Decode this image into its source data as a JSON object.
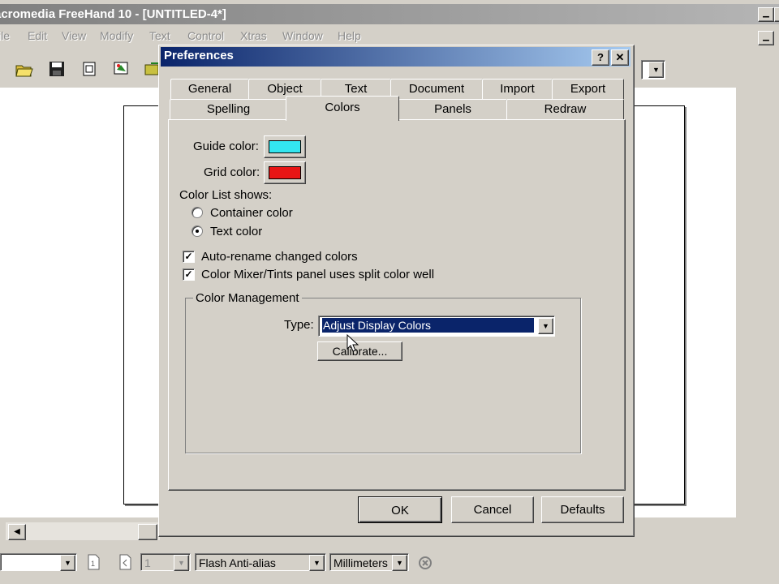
{
  "app": {
    "title": "acromedia FreeHand 10 - [UNTITLED-4*]",
    "menu": [
      "File",
      "Edit",
      "View",
      "Modify",
      "Text",
      "Control",
      "Xtras",
      "Window",
      "Help"
    ]
  },
  "statusbar": {
    "page_field": "1",
    "render_mode": "Flash Anti-alias",
    "units": "Millimeters"
  },
  "dialog": {
    "title": "Preferences",
    "help_btn": "?",
    "close_btn": "✕",
    "tabs_row1": [
      "General",
      "Object",
      "Text",
      "Document",
      "Import",
      "Export"
    ],
    "tabs_row2": [
      "Spelling",
      "Colors",
      "Panels",
      "Redraw"
    ],
    "active_tab": "Colors",
    "guide_color_label": "Guide color:",
    "guide_color": "#33e6f0",
    "grid_color_label": "Grid color:",
    "grid_color": "#e81515",
    "color_list_label": "Color List shows:",
    "radio_container": "Container color",
    "radio_text": "Text color",
    "radio_selected": "Text color",
    "check_autorename": "Auto-rename changed colors",
    "check_autorename_checked": true,
    "check_split": "Color Mixer/Tints panel uses split color well",
    "check_split_checked": true,
    "color_mgmt_title": "Color Management",
    "type_label": "Type:",
    "type_value": "Adjust Display Colors",
    "calibrate_btn": "Calibrate...",
    "ok_btn": "OK",
    "cancel_btn": "Cancel",
    "defaults_btn": "Defaults"
  }
}
